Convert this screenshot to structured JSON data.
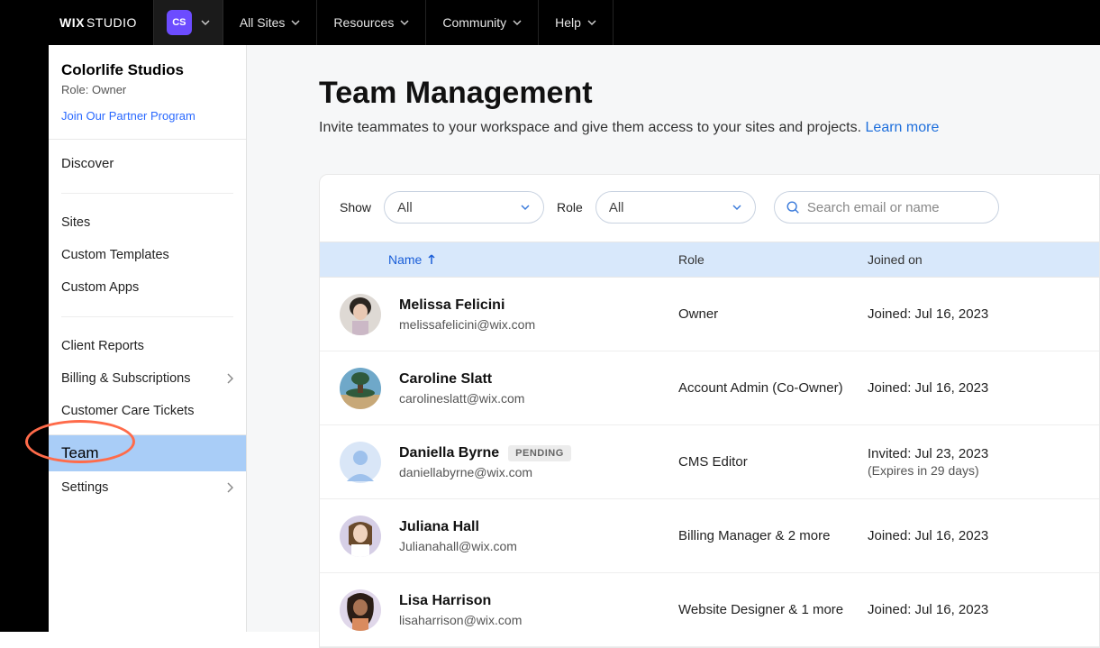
{
  "brand": {
    "wix": "WIX",
    "studio": "STUDIO"
  },
  "workspace_badge": "CS",
  "topnav": {
    "all_sites": "All Sites",
    "resources": "Resources",
    "community": "Community",
    "help": "Help"
  },
  "sidebar": {
    "workspace_name": "Colorlife Studios",
    "role_label": "Role: Owner",
    "partner_link": "Join Our Partner Program",
    "discover": "Discover",
    "sites": "Sites",
    "custom_templates": "Custom Templates",
    "custom_apps": "Custom Apps",
    "client_reports": "Client Reports",
    "billing": "Billing & Subscriptions",
    "care": "Customer Care Tickets",
    "team": "Team",
    "settings": "Settings"
  },
  "page": {
    "title": "Team Management",
    "subtitle": "Invite teammates to your workspace and give them access to your sites and projects. ",
    "learn_more": "Learn more"
  },
  "filters": {
    "show_label": "Show",
    "show_value": "All",
    "role_label": "Role",
    "role_value": "All",
    "search_placeholder": "Search email or name"
  },
  "table": {
    "head": {
      "name": "Name",
      "role": "Role",
      "joined": "Joined on"
    },
    "rows": [
      {
        "name": "Melissa Felicini",
        "email": "melissafelicini@wix.com",
        "role": "Owner",
        "joined": "Joined: Jul 16, 2023",
        "avatar": "a1"
      },
      {
        "name": "Caroline Slatt",
        "email": "carolineslatt@wix.com",
        "role": "Account Admin (Co-Owner)",
        "joined": "Joined: Jul 16, 2023",
        "avatar": "a2"
      },
      {
        "name": "Daniella Byrne",
        "email": "daniellabyrne@wix.com",
        "role": "CMS Editor",
        "joined": "Invited: Jul 23, 2023",
        "joined_sub": "(Expires in 29 days)",
        "pending": "PENDING",
        "avatar": "placeholder"
      },
      {
        "name": "Juliana Hall",
        "email": "Julianahall@wix.com",
        "role": "Billing Manager & 2 more",
        "joined": "Joined: Jul 16, 2023",
        "avatar": "a4"
      },
      {
        "name": "Lisa Harrison",
        "email": "lisaharrison@wix.com",
        "role": "Website Designer & 1 more",
        "joined": "Joined: Jul 16, 2023",
        "avatar": "a5"
      }
    ]
  }
}
